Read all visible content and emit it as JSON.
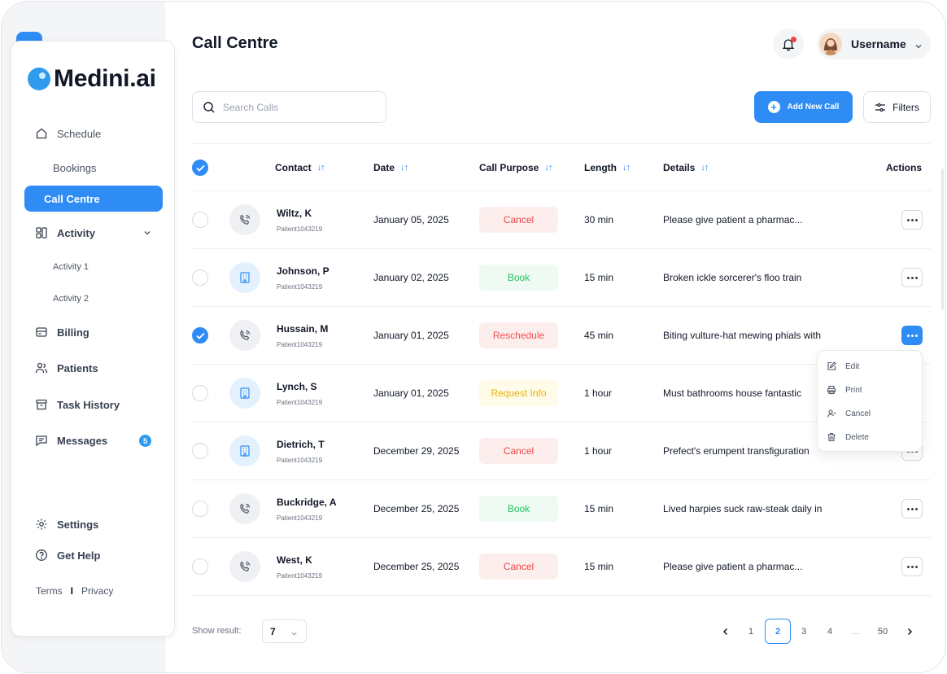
{
  "app": {
    "logo": "Medini.ai",
    "page_title": "Call Centre"
  },
  "sidebar": {
    "items": [
      {
        "label": "Schedule"
      },
      {
        "label": "Bookings"
      },
      {
        "label": "Call Centre"
      },
      {
        "label": "Activity"
      },
      {
        "label": "Activity 1"
      },
      {
        "label": "Activity 2"
      },
      {
        "label": "Billing"
      },
      {
        "label": "Patients"
      },
      {
        "label": "Task History"
      },
      {
        "label": "Messages",
        "badge": "5"
      },
      {
        "label": "Settings"
      },
      {
        "label": "Get Help"
      }
    ],
    "footer": {
      "terms": "Terms",
      "separator": "I",
      "privacy": "Privacy"
    }
  },
  "header": {
    "username": "Username"
  },
  "toolbar": {
    "search_placeholder": "Search Calls",
    "add_label": "Add New Call",
    "filters_label": "Filters"
  },
  "table": {
    "columns": {
      "contact": "Contact",
      "date": "Date",
      "purpose": "Call Purpose",
      "length": "Length",
      "details": "Details",
      "actions": "Actions"
    },
    "rows": [
      {
        "name": "Wiltz, K",
        "id": "Patient1043219",
        "date": "January 05, 2025",
        "purpose": "Cancel",
        "length": "30 min",
        "details": "Please give patient a pharmac...",
        "checked": false,
        "icon": "gray"
      },
      {
        "name": "Johnson, P",
        "id": "Patient1043219",
        "date": "January 02, 2025",
        "purpose": "Book",
        "length": "15 min",
        "details": "Broken ickle sorcerer's floo train",
        "checked": false,
        "icon": "blue"
      },
      {
        "name": "Hussain, M",
        "id": "Patient1043219",
        "date": "January 01, 2025",
        "purpose": "Reschedule",
        "length": "45 min",
        "details": "Biting vulture-hat mewing phials with",
        "checked": true,
        "icon": "gray"
      },
      {
        "name": "Lynch, S",
        "id": "Patient1043219",
        "date": "January 01, 2025",
        "purpose": "Request Info",
        "length": "1 hour",
        "details": "Must bathrooms house fantastic",
        "checked": false,
        "icon": "blue"
      },
      {
        "name": "Dietrich, T",
        "id": "Patient1043219",
        "date": "December 29, 2025",
        "purpose": "Cancel",
        "length": "1 hour",
        "details": "Prefect's erumpent transfiguration",
        "checked": false,
        "icon": "blue"
      },
      {
        "name": "Buckridge, A",
        "id": "Patient1043219",
        "date": "December 25, 2025",
        "purpose": "Book",
        "length": "15 min",
        "details": "Lived harpies suck raw-steak daily in",
        "checked": false,
        "icon": "gray"
      },
      {
        "name": "West, K",
        "id": "Patient1043219",
        "date": "December 25, 2025",
        "purpose": "Cancel",
        "length": "15 min",
        "details": "Please give patient a pharmac...",
        "checked": false,
        "icon": "gray"
      }
    ]
  },
  "action_menu": {
    "items": [
      "Edit",
      "Print",
      "Cancel",
      "Delete"
    ]
  },
  "pagination": {
    "show_label": "Show result:",
    "show_value": "7",
    "pages": [
      "1",
      "2",
      "3",
      "4",
      "...",
      "50"
    ],
    "current": "2"
  },
  "colors": {
    "accent": "#2f8cf4",
    "cancel": "#ef4444",
    "book": "#22c55e",
    "request_info": "#eab308"
  }
}
